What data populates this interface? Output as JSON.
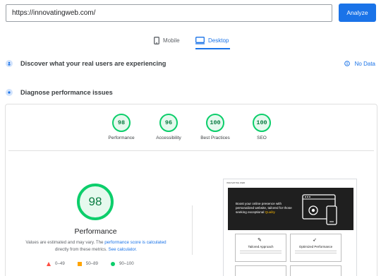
{
  "search": {
    "value": "https://innovatingweb.com/"
  },
  "analyze_label": "Analyze",
  "tabs": [
    {
      "label": "Mobile",
      "icon": "mobile-icon",
      "active": false
    },
    {
      "label": "Desktop",
      "icon": "desktop-icon",
      "active": true
    }
  ],
  "crux": {
    "title": "Discover what your real users are experiencing",
    "status": "No Data"
  },
  "diagnose": {
    "title": "Diagnose performance issues"
  },
  "scores": [
    {
      "value": "98",
      "label": "Performance"
    },
    {
      "value": "96",
      "label": "Accessibility"
    },
    {
      "value": "100",
      "label": "Best Practices"
    },
    {
      "value": "100",
      "label": "SEO"
    }
  ],
  "performance": {
    "score": "98",
    "title": "Performance",
    "note_prefix": "Values are estimated and may vary. The",
    "note_link1": "performance score is calculated",
    "note_middle": "directly from these metrics.",
    "note_link2": "See calculator."
  },
  "legend": [
    {
      "range": "0–49",
      "shape": "triangle",
      "color": "#ff4e42"
    },
    {
      "range": "50–89",
      "shape": "square",
      "color": "#ffa400"
    },
    {
      "range": "90–100",
      "shape": "circle",
      "color": "#0cce6b"
    }
  ],
  "thumbnail": {
    "header": "INNOVATING WEB",
    "hero_text": "Boost your online presence with personalized website, tailored for those seeking exceptional",
    "hero_highlight": "Quality",
    "features": [
      {
        "title": "Tailored Approach",
        "icon": "brush-icon"
      },
      {
        "title": "Optimized Performance",
        "icon": "rocket-icon"
      }
    ]
  },
  "colors": {
    "accent": "#1a73e8",
    "pass": "#0cce6b",
    "average": "#ffa400",
    "fail": "#ff4e42"
  }
}
